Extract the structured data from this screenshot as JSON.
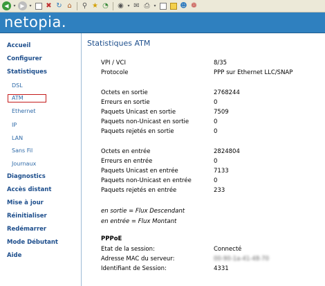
{
  "toolbar": {
    "icons": [
      "back-icon",
      "forward-icon",
      "document-icon",
      "stop-icon",
      "refresh-icon",
      "home-icon",
      "search-icon",
      "favorites-star-icon",
      "history-icon",
      "media-icon",
      "mail-icon",
      "print-icon",
      "edit-icon",
      "folder-icon",
      "messenger-icon",
      "tool-icon"
    ]
  },
  "header": {
    "logo": "netopia."
  },
  "sidebar": {
    "accueil": "Accueil",
    "configurer": "Configurer",
    "statistiques": "Statistiques",
    "dsl": "DSL",
    "atm": "ATM",
    "ethernet": "Ethernet",
    "ip": "IP",
    "lan": "LAN",
    "sans_fil": "Sans Fil",
    "journaux": "Journaux",
    "diagnostics": "Diagnostics",
    "acces_distant": "Accès distant",
    "mise_a_jour": "Mise à jour",
    "reinitialiser": "Réinitialiser",
    "redemarrer": "Redémarrer",
    "mode_debutant": "Mode Débutant",
    "aide": "Aide"
  },
  "main": {
    "title": "Statistiques ATM",
    "rows": [
      {
        "label": "VPI / VCI",
        "value": "8/35"
      },
      {
        "label": "Protocole",
        "value": "PPP sur Ethernet LLC/SNAP"
      },
      {
        "label": "Octets en sortie",
        "value": "2768244"
      },
      {
        "label": "Erreurs en sortie",
        "value": "0"
      },
      {
        "label": "Paquets Unicast en sortie",
        "value": "7509"
      },
      {
        "label": "Paquets non-Unicast en sortie",
        "value": "0"
      },
      {
        "label": "Paquets rejetés en sortie",
        "value": "0"
      },
      {
        "label": "Octets en entrée",
        "value": "2824804"
      },
      {
        "label": "Erreurs en entrée",
        "value": "0"
      },
      {
        "label": "Paquets Unicast en entrée",
        "value": "7133"
      },
      {
        "label": "Paquets non-Unicast en entrée",
        "value": "0"
      },
      {
        "label": "Paquets rejetés en entrée",
        "value": "233"
      }
    ],
    "notes": [
      "en sortie = Flux Descendant",
      "en entrée = Flux Montant"
    ],
    "pppoe": {
      "title": "PPPoE",
      "rows": [
        {
          "label": "Etat de la session:",
          "value": "Connecté"
        },
        {
          "label": "Adresse MAC du serveur:",
          "value": "00-90-1a-41-48-70"
        },
        {
          "label": "Identifiant de Session:",
          "value": "4331"
        }
      ]
    }
  }
}
